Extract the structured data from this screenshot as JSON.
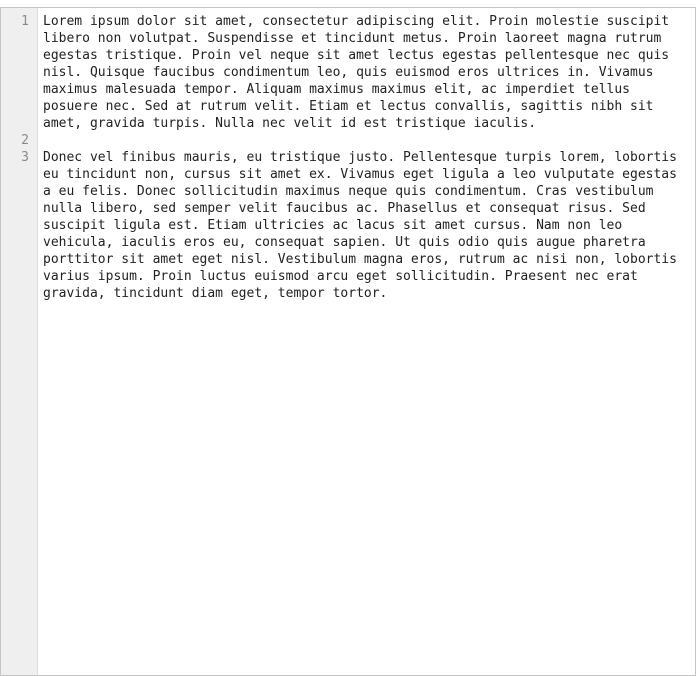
{
  "editor": {
    "lines": [
      {
        "number": "1",
        "text": "Lorem ipsum dolor sit amet, consectetur adipiscing elit. Proin molestie suscipit libero non volutpat. Suspendisse et tincidunt metus. Proin laoreet magna rutrum egestas tristique. Proin vel neque sit amet lectus egestas pellentesque nec quis nisl. Quisque faucibus condimentum leo, quis euismod eros ultrices in. Vivamus maximus malesuada tempor. Aliquam maximus maximus elit, ac imperdiet tellus posuere nec. Sed at rutrum velit. Etiam et lectus convallis, sagittis nibh sit amet, gravida turpis. Nulla nec velit id est tristique iaculis."
      },
      {
        "number": "2",
        "text": ""
      },
      {
        "number": "3",
        "text": "Donec vel finibus mauris, eu tristique justo. Pellentesque turpis lorem, lobortis eu tincidunt non, cursus sit amet ex. Vivamus eget ligula a leo vulputate egestas a eu felis. Donec sollicitudin maximus neque quis condimentum. Cras vestibulum nulla libero, sed semper velit faucibus ac. Phasellus et consequat risus. Sed suscipit ligula est. Etiam ultricies ac lacus sit amet cursus. Nam non leo vehicula, iaculis eros eu, consequat sapien. Ut quis odio quis augue pharetra porttitor sit amet eget nisl. Vestibulum magna eros, rutrum ac nisi non, lobortis varius ipsum. Proin luctus euismod arcu eget sollicitudin. Praesent nec erat gravida, tincidunt diam eget, tempor tortor."
      }
    ]
  },
  "colors": {
    "gutter_background": "#efefef",
    "line_number": "#8a8a8a",
    "text": "#222222",
    "border": "#c4c4c4"
  }
}
